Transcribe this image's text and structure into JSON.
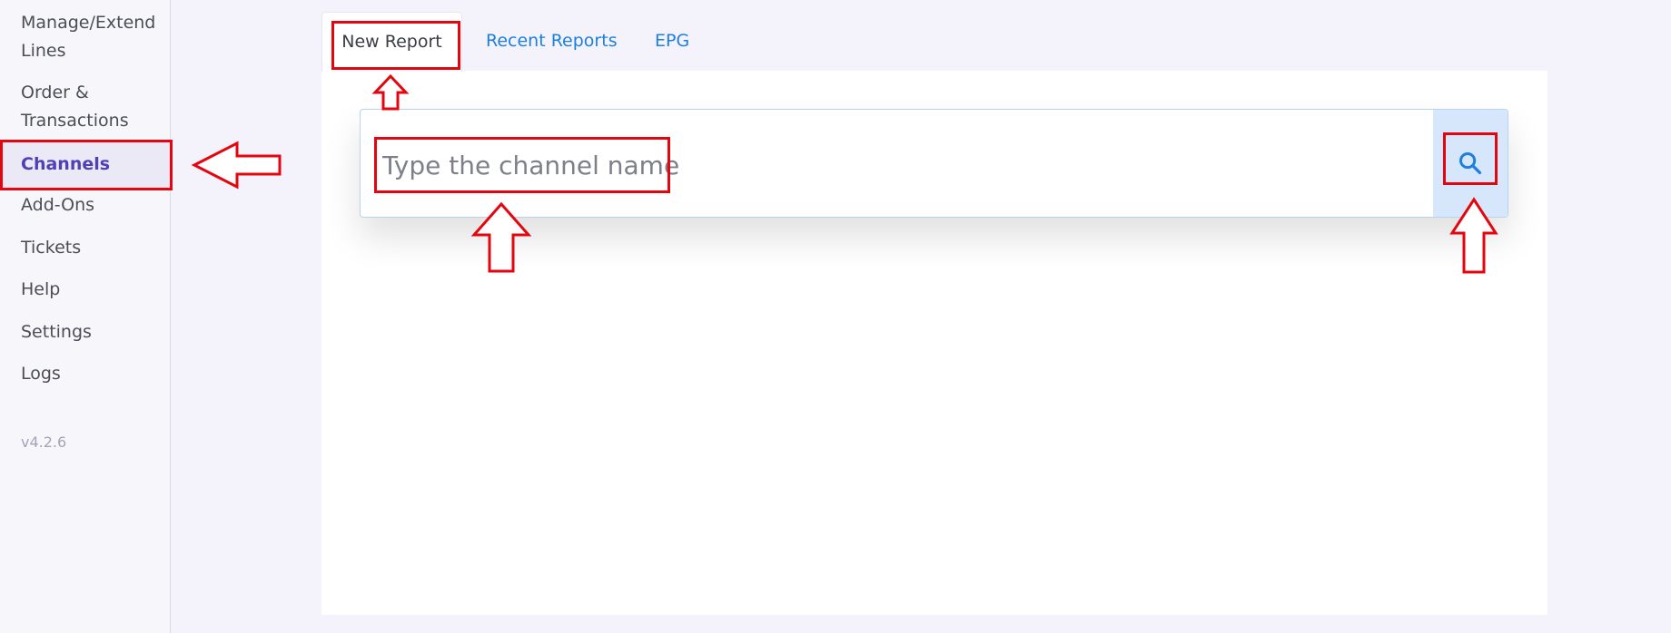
{
  "sidebar": {
    "items": [
      {
        "label": "Manage/Extend",
        "label2": "Lines"
      },
      {
        "label": "Order &",
        "label2": "Transactions"
      },
      {
        "label": "Channels"
      },
      {
        "label": "Add-Ons"
      },
      {
        "label": "Tickets"
      },
      {
        "label": "Help"
      },
      {
        "label": "Settings"
      },
      {
        "label": "Logs"
      }
    ],
    "active": "Channels",
    "version": "v4.2.6"
  },
  "tabs": [
    {
      "label": "New Report",
      "active": true
    },
    {
      "label": "Recent Reports",
      "active": false
    },
    {
      "label": "EPG",
      "active": false
    }
  ],
  "search": {
    "placeholder": "Type the channel name",
    "value": "",
    "button_icon": "search-icon"
  },
  "colors": {
    "accent": "#5040b8",
    "link": "#1d7fe0",
    "annotation": "#e3060f",
    "search_button_bg": "#d6e7fb"
  }
}
